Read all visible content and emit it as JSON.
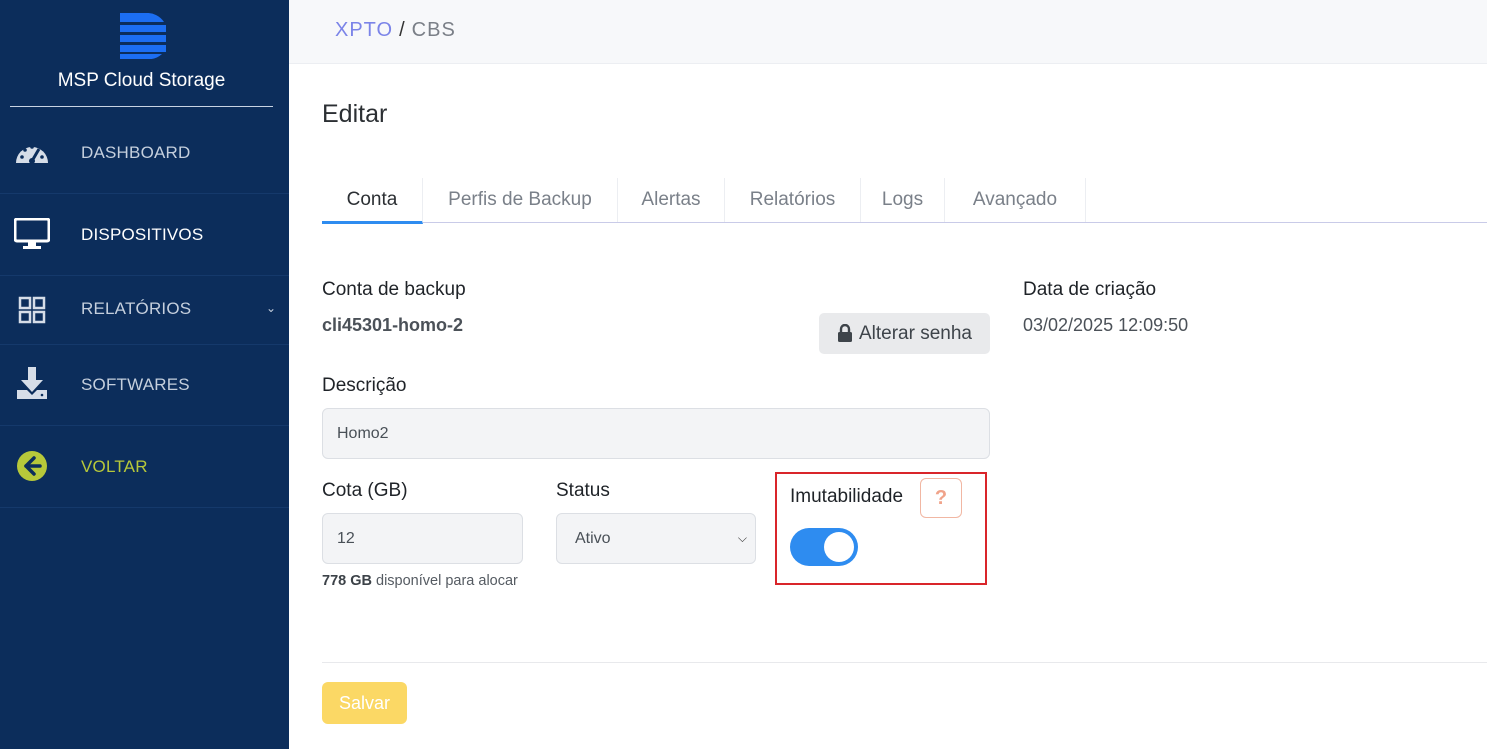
{
  "brand": {
    "name": "MSP Cloud Storage",
    "logo_icon": "stacked-d-logo-icon"
  },
  "sidebar": {
    "items": [
      {
        "label": "DASHBOARD",
        "icon": "speedometer-icon"
      },
      {
        "label": "DISPOSITIVOS",
        "icon": "monitor-icon",
        "active": true
      },
      {
        "label": "RELATÓRIOS",
        "icon": "grid-icon",
        "chevron": "chevron-down-icon"
      },
      {
        "label": "SOFTWARES",
        "icon": "download-icon"
      },
      {
        "label": "VOLTAR",
        "icon": "arrow-left-circle-icon"
      }
    ]
  },
  "breadcrumb": {
    "parent": "XPTO",
    "separator": "/",
    "current": "CBS"
  },
  "page": {
    "title": "Editar"
  },
  "tabs": [
    {
      "label": "Conta",
      "active": true
    },
    {
      "label": "Perfis de Backup"
    },
    {
      "label": "Alertas"
    },
    {
      "label": "Relatórios"
    },
    {
      "label": "Logs"
    },
    {
      "label": "Avançado"
    }
  ],
  "form": {
    "account_label": "Conta de backup",
    "account_value": "cli45301-homo-2",
    "change_password_label": "Alterar senha",
    "created_label": "Data de criação",
    "created_value": "03/02/2025 12:09:50",
    "description_label": "Descrição",
    "description_value": "Homo2",
    "quota_label": "Cota (GB)",
    "quota_value": "12",
    "quota_available_amount": "778 GB",
    "quota_available_text": "disponível para alocar",
    "status_label": "Status",
    "status_value": "Ativo",
    "immutability_label": "Imutabilidade",
    "immutability_help": "?",
    "immutability_enabled": true,
    "save_label": "Salvar"
  },
  "colors": {
    "sidebar_bg": "#0c2d5b",
    "accent_blue": "#2e8cf0",
    "save_yellow": "#fbd865",
    "back_green": "#b7c83a",
    "highlight_red": "#d9252a"
  }
}
